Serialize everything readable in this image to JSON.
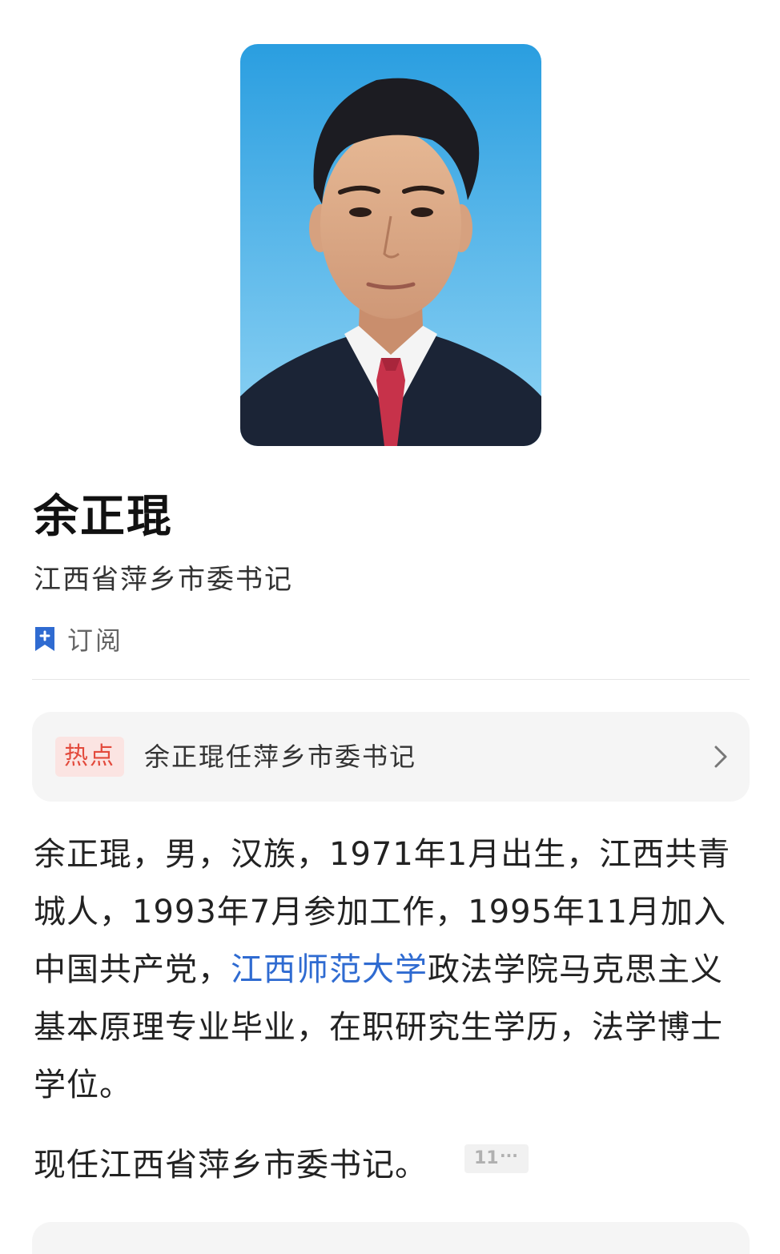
{
  "profile": {
    "name": "余正琨",
    "position": "江西省萍乡市委书记"
  },
  "subscribe": {
    "label": "订阅",
    "icon": "bookmark-plus-icon",
    "color": "#2f6bd1"
  },
  "hot": {
    "badge": "热点",
    "text": "余正琨任萍乡市委书记",
    "icon": "chevron-right-icon"
  },
  "bio": {
    "part1": "余正琨，男，汉族，1971年1月出生，江西共青城人，1993年7月参加工作，1995年11月加入中国共产党，",
    "link": "江西师范大学",
    "part2": "政法学院马克思主义基本原理专业毕业，在职研究生学历，法学博士学位。",
    "current": "现任江西省萍乡市委书记。",
    "reference": "11",
    "reference_more": "···"
  },
  "colors": {
    "link": "#2f6bd1",
    "hot_badge_bg": "#fbe4e2",
    "hot_badge_text": "#e34a3c"
  }
}
